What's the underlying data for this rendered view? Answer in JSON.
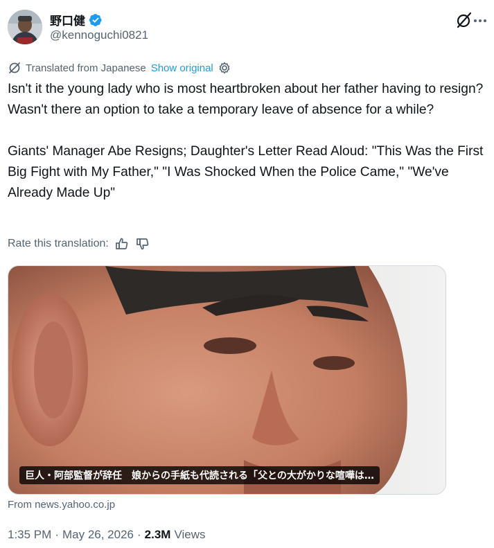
{
  "author": {
    "display_name": "野口健",
    "handle": "@kennoguchi0821",
    "verified": true,
    "avatar_icon": "avatar-photo"
  },
  "translation": {
    "label": "Translated from Japanese",
    "show_original": "Show original",
    "settings_icon": "gear-icon",
    "rate_label": "Rate this translation:"
  },
  "tweet": {
    "text": "Isn't it the young lady who is most heartbroken about her father having to resign? Wasn't there an option to take a temporary leave of absence for a while?\n\nGiants' Manager Abe Resigns; Daughter's Letter Read Aloud: \"This Was the First Big Fight with My Father,\" \"I Was Shocked When the Police Came,\" \"We've Already Made Up\""
  },
  "card": {
    "caption": "巨人・阿部監督が辞任　娘からの手紙も代読される「父との大がかりな喧嘩は…",
    "source": "From news.yahoo.co.jp"
  },
  "meta": {
    "time": "1:35 PM",
    "separator": "·",
    "date": "May 26, 2026",
    "views_count": "2.3M",
    "views_label": "Views"
  },
  "colors": {
    "text": "#0f1419",
    "secondary": "#536471",
    "link": "#1d9bf0",
    "border": "#cfd9de"
  }
}
